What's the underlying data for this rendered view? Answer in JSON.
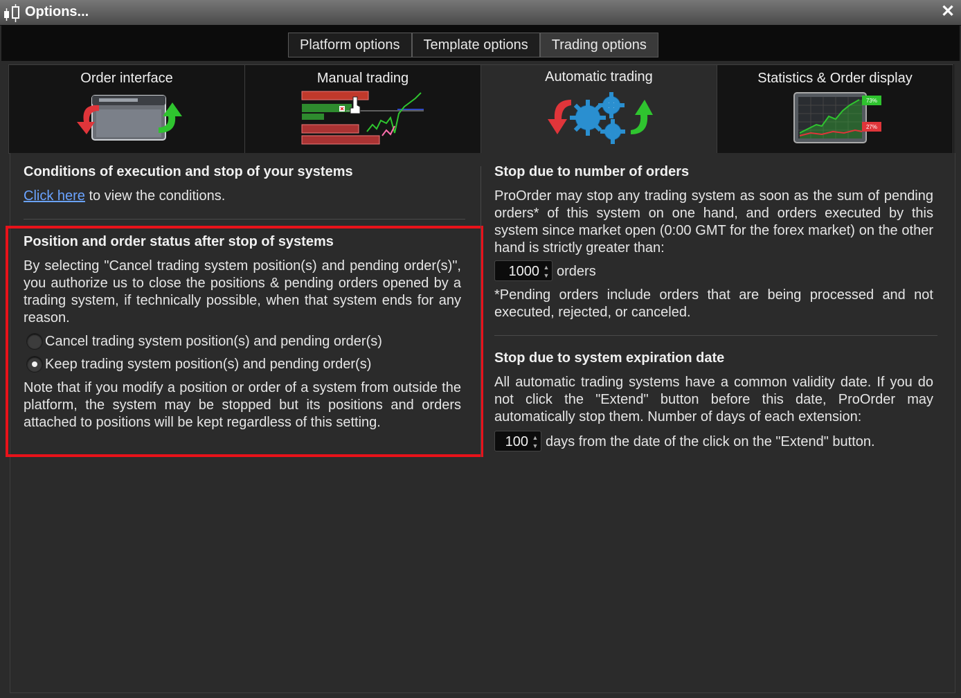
{
  "window": {
    "title": "Options...",
    "close_glyph": "✕"
  },
  "top_tabs": [
    {
      "label": "Platform options",
      "active": false
    },
    {
      "label": "Template options",
      "active": false
    },
    {
      "label": "Trading options",
      "active": true
    }
  ],
  "sub_tabs": [
    {
      "label": "Order interface",
      "active": false,
      "icon": "order-window-icon"
    },
    {
      "label": "Manual trading",
      "active": false,
      "icon": "manual-trading-icon"
    },
    {
      "label": "Automatic trading",
      "active": true,
      "icon": "gears-icon"
    },
    {
      "label": "Statistics & Order display",
      "active": false,
      "icon": "statistics-chart-icon"
    }
  ],
  "left": {
    "conditions": {
      "heading": "Conditions of execution and stop of your systems",
      "link": "Click here",
      "link_suffix": "to view the conditions."
    },
    "position_status": {
      "heading": "Position and order status after stop of systems",
      "description": "By selecting \"Cancel trading system position(s) and pending order(s)\", you authorize us to close the positions & pending orders opened by a trading system, if technically possible, when that system ends for any reason.",
      "options": [
        {
          "label": "Cancel trading system position(s) and pending order(s)",
          "checked": false
        },
        {
          "label": "Keep trading system position(s) and pending order(s)",
          "checked": true
        }
      ],
      "note": "Note that if you modify a position or order of a system from outside the platform, the system may be stopped but its positions and orders attached to positions will be kept regardless of this setting."
    }
  },
  "right": {
    "orders_stop": {
      "heading": "Stop due to number of orders",
      "description": "ProOrder may stop any trading system as soon as the sum of pending orders* of this system on one hand, and orders executed by this system since market open (0:00 GMT for the forex market) on the other hand is strictly greater than:",
      "value": "1000",
      "unit": "orders",
      "footnote": "*Pending orders include orders that are being processed and not executed, rejected, or canceled."
    },
    "expiration_stop": {
      "heading": "Stop due to system expiration date",
      "description": "All automatic trading systems have a common validity date. If you do not click the \"Extend\" button before this date, ProOrder may automatically stop them. Number of days of each extension:",
      "value": "100",
      "suffix": "days from the date of the click on the \"Extend\" button."
    }
  },
  "stats_icon": {
    "up_pct": "73%",
    "down_pct": "27%"
  },
  "colors": {
    "highlight": "#e8121a",
    "link": "#6aa3ff",
    "green": "#2fc42f",
    "red": "#e0353a",
    "gear_blue": "#2a8fd0"
  }
}
